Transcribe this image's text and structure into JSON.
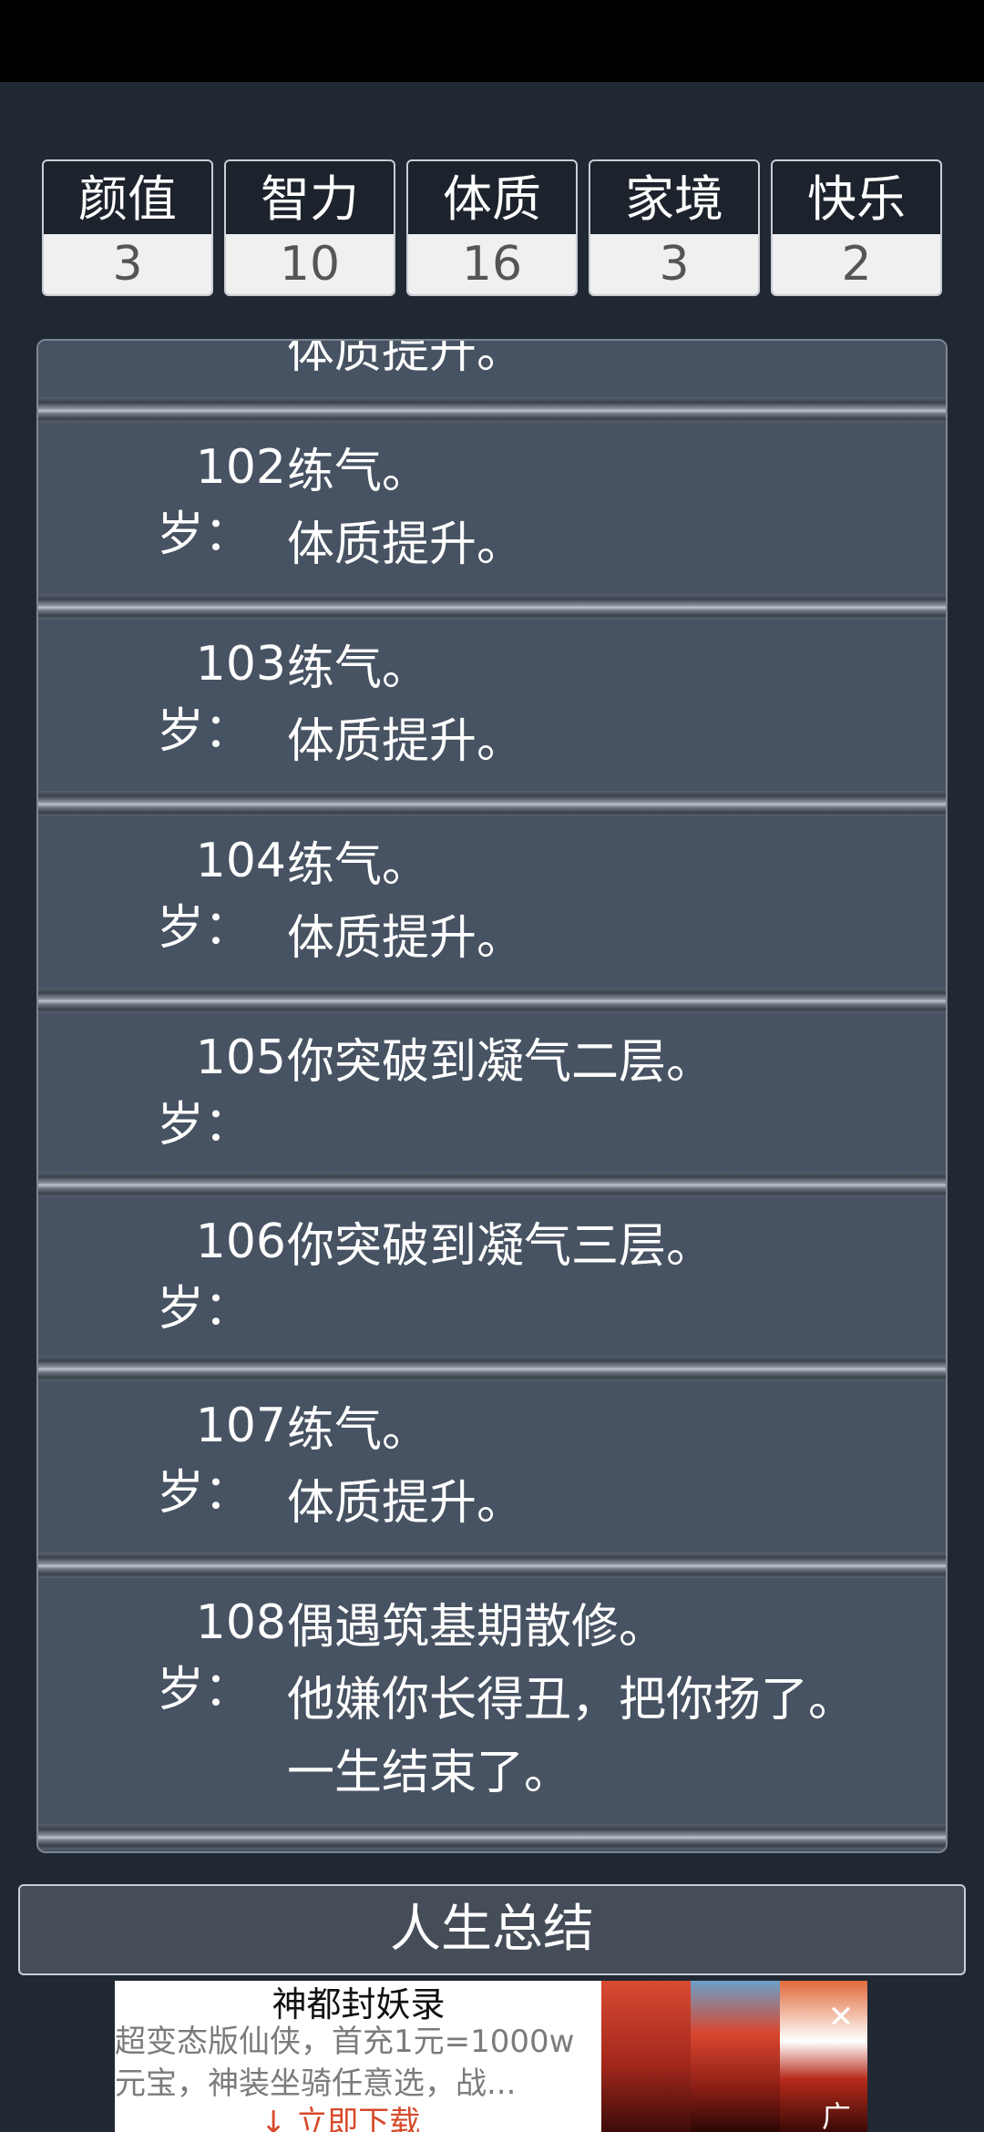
{
  "stats": [
    {
      "label": "颜值",
      "value": "3"
    },
    {
      "label": "智力",
      "value": "10"
    },
    {
      "label": "体质",
      "value": "16"
    },
    {
      "label": "家境",
      "value": "3"
    },
    {
      "label": "快乐",
      "value": "2"
    }
  ],
  "log": {
    "partial_entry": {
      "text": "体质提升。"
    },
    "entries": [
      {
        "age": "102",
        "suffix": "岁：",
        "lines": [
          "练气。",
          "体质提升。"
        ]
      },
      {
        "age": "103",
        "suffix": "岁：",
        "lines": [
          "练气。",
          "体质提升。"
        ]
      },
      {
        "age": "104",
        "suffix": "岁：",
        "lines": [
          "练气。",
          "体质提升。"
        ]
      },
      {
        "age": "105",
        "suffix": "岁：",
        "lines": [
          "你突破到凝气二层。"
        ]
      },
      {
        "age": "106",
        "suffix": "岁：",
        "lines": [
          "你突破到凝气三层。"
        ]
      },
      {
        "age": "107",
        "suffix": "岁：",
        "lines": [
          "练气。",
          "体质提升。"
        ]
      },
      {
        "age": "108",
        "suffix": "岁：",
        "lines": [
          "偶遇筑基期散修。",
          "他嫌你长得丑，把你扬了。",
          "一生结束了。"
        ]
      }
    ]
  },
  "summary_button": "人生总结",
  "ad": {
    "title": "神都封妖录",
    "description": "超变态版仙侠，首充1元=1000w元宝，神装坐骑任意选，战...",
    "cta": "↓ 立即下载",
    "tag": "广告",
    "close_icon": "close-icon"
  }
}
